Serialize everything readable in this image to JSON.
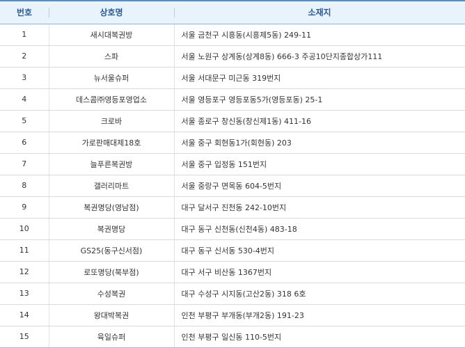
{
  "table": {
    "headers": {
      "number": "번호",
      "name": "상호명",
      "address": "소재지"
    },
    "rows": [
      {
        "no": "1",
        "name": "새시대복권방",
        "address": "서울 금천구 시흥동(시흥제5동) 249-11"
      },
      {
        "no": "2",
        "name": "스파",
        "address": "서울 노원구 상계동(상계8동) 666-3 주공10단지종합상가111"
      },
      {
        "no": "3",
        "name": "뉴서울슈퍼",
        "address": "서울 서대문구 미근동 319번지"
      },
      {
        "no": "4",
        "name": "데스콤㈜영등포영업소",
        "address": "서울 영등포구 영등포동5가(영등포동) 25-1"
      },
      {
        "no": "5",
        "name": "크로바",
        "address": "서울 종로구 창신동(창신제1동) 411-16"
      },
      {
        "no": "6",
        "name": "가로판매대제18호",
        "address": "서울 중구 회현동1가(회현동) 203"
      },
      {
        "no": "7",
        "name": "늘푸른복권방",
        "address": "서울 중구 입정동 151번지"
      },
      {
        "no": "8",
        "name": "갤러리마트",
        "address": "서울 중랑구 면목동 604-5번지"
      },
      {
        "no": "9",
        "name": "복권명당(영남점)",
        "address": "대구 달서구 진천동 242-10번지"
      },
      {
        "no": "10",
        "name": "복권명당",
        "address": "대구 동구 신천동(신천4동) 483-18"
      },
      {
        "no": "11",
        "name": "GS25(동구신서점)",
        "address": "대구 동구 신서동 530-4번지"
      },
      {
        "no": "12",
        "name": "로또명당(북부점)",
        "address": "대구 서구 비산동 1367번지"
      },
      {
        "no": "13",
        "name": "수성복권",
        "address": "대구 수성구 시지동(고산2동) 318 6호"
      },
      {
        "no": "14",
        "name": "왕대박복권",
        "address": "인천 부평구 부개동(부개2동) 191-23"
      },
      {
        "no": "15",
        "name": "육일슈퍼",
        "address": "인천 부평구 일신동 110-5번지"
      }
    ]
  }
}
